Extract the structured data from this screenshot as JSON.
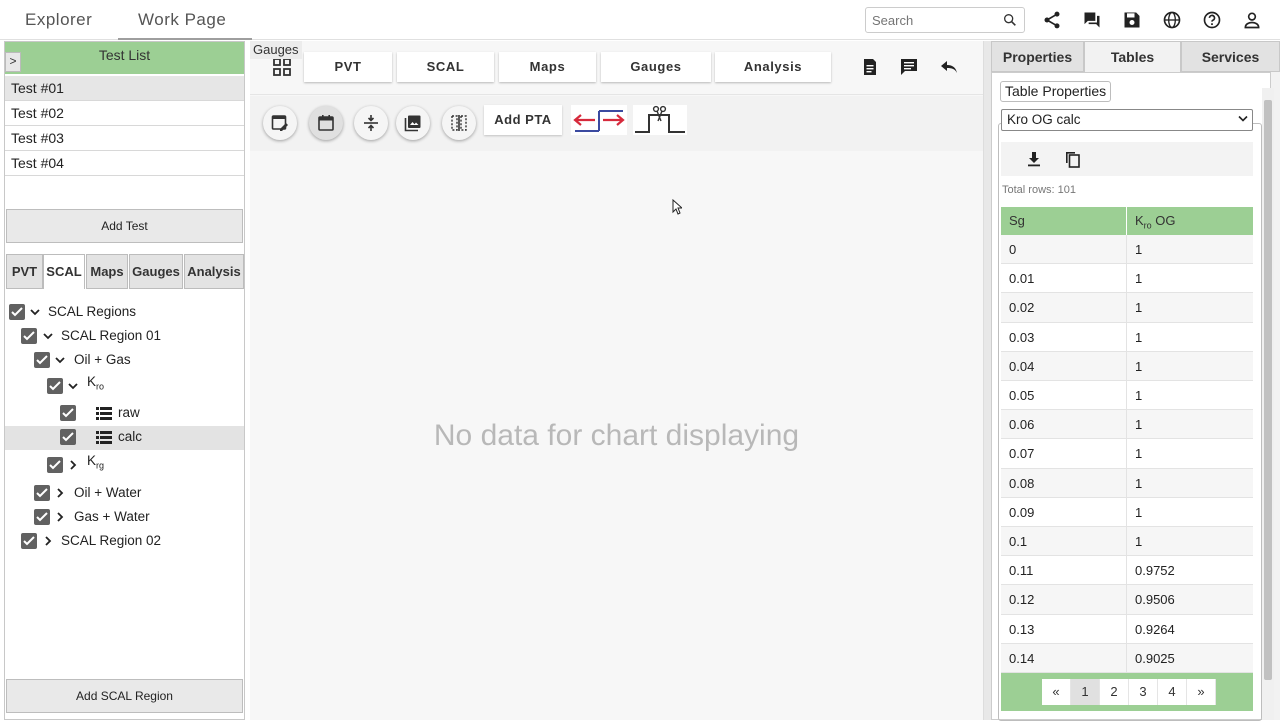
{
  "topbar": {
    "tabs": [
      {
        "label": "Explorer"
      },
      {
        "label": "Work Page"
      }
    ],
    "search_placeholder": "Search"
  },
  "left": {
    "header": "Test List",
    "toggle": ">",
    "tests": [
      "Test #01",
      "Test #02",
      "Test #03",
      "Test #04"
    ],
    "add_test": "Add Test",
    "tabs": [
      "PVT",
      "SCAL",
      "Maps",
      "Gauges",
      "Analysis"
    ],
    "active_tab": "SCAL",
    "tree": {
      "root": "SCAL Regions",
      "region1": "SCAL Region 01",
      "oil_gas": "Oil + Gas",
      "kro_main": "K",
      "kro_sub": "ro",
      "raw": "raw",
      "calc": "calc",
      "krg_main": "K",
      "krg_sub": "rg",
      "oil_water": "Oil + Water",
      "gas_water": "Gas + Water",
      "region2": "SCAL Region 02"
    },
    "add_region": "Add SCAL Region"
  },
  "center": {
    "tabs": [
      "PVT",
      "SCAL",
      "Maps",
      "Gauges",
      "Analysis"
    ],
    "add_pta": "Add PTA",
    "tooltip": "Gauges",
    "empty_message": "No data for chart displaying"
  },
  "right": {
    "tabs": [
      "Properties",
      "Tables",
      "Services"
    ],
    "active_tab": "Tables",
    "legend": "Table Properties",
    "selected_table": "Kro OG calc",
    "total_rows": "Total rows: 101",
    "table": {
      "col1": "Sg",
      "col2_main": "K",
      "col2_sub": "ro",
      "col2_suffix": " OG",
      "rows": [
        [
          "0",
          "1"
        ],
        [
          "0.01",
          "1"
        ],
        [
          "0.02",
          "1"
        ],
        [
          "0.03",
          "1"
        ],
        [
          "0.04",
          "1"
        ],
        [
          "0.05",
          "1"
        ],
        [
          "0.06",
          "1"
        ],
        [
          "0.07",
          "1"
        ],
        [
          "0.08",
          "1"
        ],
        [
          "0.09",
          "1"
        ],
        [
          "0.1",
          "1"
        ],
        [
          "0.11",
          "0.9752"
        ],
        [
          "0.12",
          "0.9506"
        ],
        [
          "0.13",
          "0.9264"
        ],
        [
          "0.14",
          "0.9025"
        ]
      ]
    },
    "pager": [
      "«",
      "1",
      "2",
      "3",
      "4",
      "»"
    ],
    "active_page": "1"
  },
  "colors": {
    "accent_green": "#9ccf94",
    "icon": "#222222"
  }
}
